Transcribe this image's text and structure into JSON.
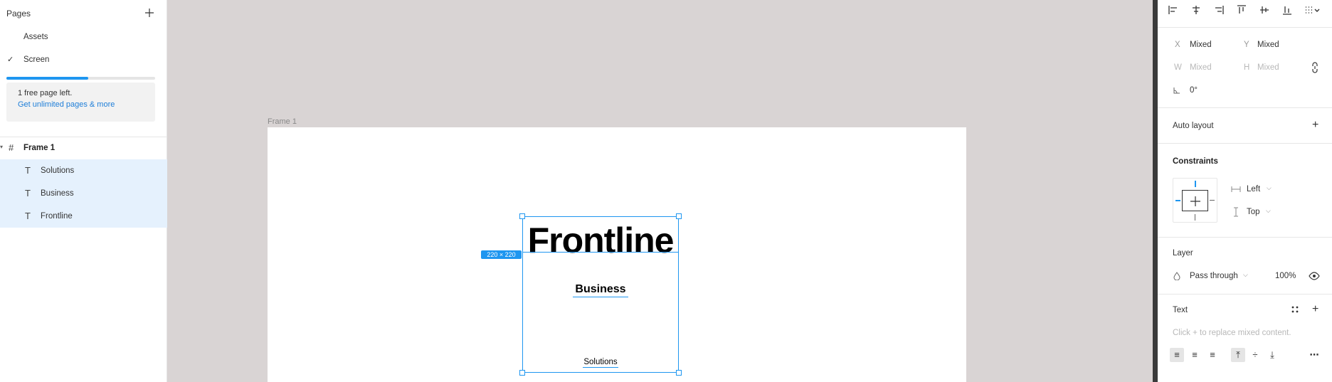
{
  "left_panel": {
    "pages_title": "Pages",
    "pages": [
      {
        "label": "Assets",
        "current": false
      },
      {
        "label": "Screen",
        "current": true
      }
    ],
    "check_glyph": "✓",
    "page_usage_fraction": 0.55,
    "promo": {
      "text": "1 free page left.",
      "link": "Get unlimited pages & more"
    },
    "layers": {
      "frame": {
        "name": "Frame 1",
        "icon": "frame-grid-icon"
      },
      "children": [
        {
          "name": "Solutions",
          "icon": "text-layer-icon"
        },
        {
          "name": "Business",
          "icon": "text-layer-icon"
        },
        {
          "name": "Frontline",
          "icon": "text-layer-icon"
        }
      ]
    }
  },
  "canvas": {
    "frame_label": "Frame 1",
    "texts": {
      "frontline": "Frontline",
      "business": "Business",
      "solutions": "Solutions"
    },
    "size_badge": "220 × 220"
  },
  "right_panel": {
    "position": {
      "x_label": "X",
      "x_value": "Mixed",
      "y_label": "Y",
      "y_value": "Mixed",
      "w_label": "W",
      "w_value": "Mixed",
      "h_label": "H",
      "h_value": "Mixed",
      "rotation": "0°"
    },
    "auto_layout": "Auto layout",
    "constraints": {
      "title": "Constraints",
      "horizontal": "Left",
      "vertical": "Top"
    },
    "layer": {
      "title": "Layer",
      "blend": "Pass through",
      "opacity": "100%"
    },
    "text": {
      "title": "Text",
      "hint": "Click + to replace mixed content."
    }
  },
  "colors": {
    "accent": "#1e96f0",
    "canvas_bg": "#d9d4d4",
    "selection_bg": "#e5f1fd"
  }
}
